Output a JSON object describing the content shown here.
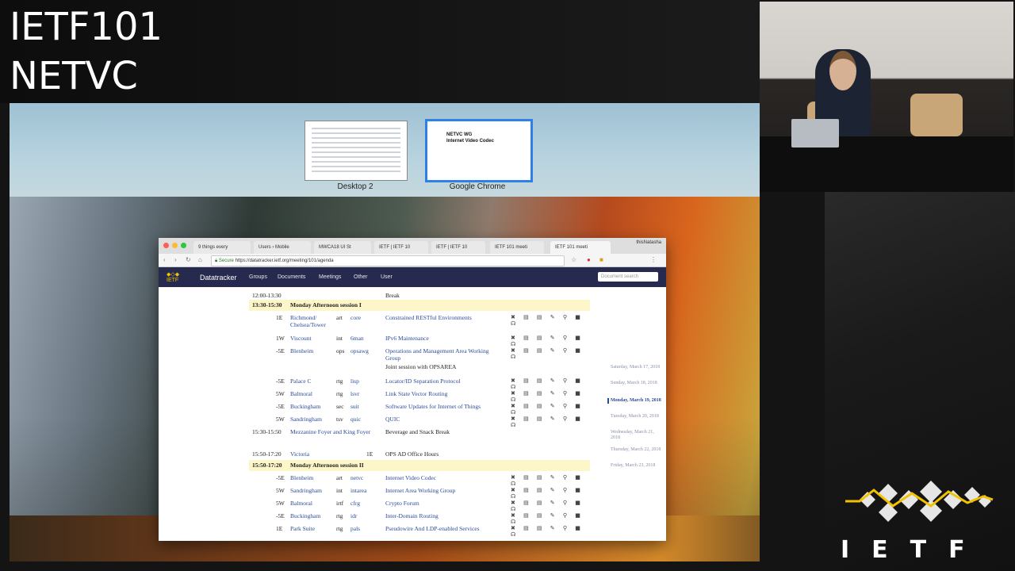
{
  "title": {
    "line1": "IETF101",
    "line2": "NETVC"
  },
  "spaces": [
    {
      "label": "Desktop 2"
    },
    {
      "label": "Google Chrome"
    }
  ],
  "thumb_slide": {
    "line1": "NETVC WG",
    "line2": "Internet Video Codec"
  },
  "browser": {
    "tabs": [
      "9 things every",
      "Users › Mobile",
      "MWCA18 UI St",
      "IETF | IETF 10",
      "IETF | IETF 10",
      "IETF 101 meeti",
      "IETF 101 meeti"
    ],
    "profile": "thisNatasha",
    "address": {
      "secure": "Secure",
      "url": "https://datatracker.ietf.org/meeting/101/agenda"
    },
    "site": {
      "logo": "IETF",
      "brand": "Datatracker",
      "nav": [
        "Groups",
        "Documents",
        "Meetings",
        "Other",
        "User"
      ],
      "search_placeholder": "Document search"
    }
  },
  "agenda": [
    {
      "type": "plain",
      "time": "12:00-13:30",
      "title": "Break"
    },
    {
      "type": "header",
      "time": "13:30-15:30",
      "title": "Monday Afternoon session I"
    },
    {
      "type": "session",
      "floor": "1E",
      "room": "Richmond/ Chelsea/Tower",
      "area": "art",
      "group": "core",
      "title": "Constrained RESTful Environments"
    },
    {
      "type": "session",
      "floor": "1W",
      "room": "Viscount",
      "area": "int",
      "group": "6man",
      "title": "IPv6 Maintenance"
    },
    {
      "type": "session",
      "floor": "-5E",
      "room": "Blenheim",
      "area": "ops",
      "group": "opsawg",
      "title": "Operations and Management Area Working Group",
      "note": "Joint session with OPSAREA"
    },
    {
      "type": "session",
      "floor": "-5E",
      "room": "Palace C",
      "area": "rtg",
      "group": "lisp",
      "title": "Locator/ID Separation Protocol"
    },
    {
      "type": "session",
      "floor": "5W",
      "room": "Balmoral",
      "area": "rtg",
      "group": "lsvr",
      "title": "Link State Vector Routing"
    },
    {
      "type": "session",
      "floor": "-5E",
      "room": "Buckingham",
      "area": "sec",
      "group": "suit",
      "title": "Software Updates for Internet of Things"
    },
    {
      "type": "session",
      "floor": "5W",
      "room": "Sandringham",
      "area": "tsv",
      "group": "quic",
      "title": "QUIC"
    },
    {
      "type": "plain",
      "time": "15:30-15:50",
      "room": "Mezzanine Foyer and King Foyer",
      "title": "Beverage and Snack Break"
    },
    {
      "type": "plain",
      "time": "15:50-17:20",
      "room": "Victoria",
      "floor": "1E",
      "title": "OPS AD Office Hours"
    },
    {
      "type": "header",
      "time": "15:50-17:20",
      "title": "Monday Afternoon session II"
    },
    {
      "type": "session",
      "floor": "-5E",
      "room": "Blenheim",
      "area": "art",
      "group": "netvc",
      "title": "Internet Video Codec"
    },
    {
      "type": "session",
      "floor": "5W",
      "room": "Sandringham",
      "area": "int",
      "group": "intarea",
      "title": "Internet Area Working Group"
    },
    {
      "type": "session",
      "floor": "5W",
      "room": "Balmoral",
      "area": "irtf",
      "group": "cfrg",
      "title": "Crypto Forum"
    },
    {
      "type": "session",
      "floor": "-5E",
      "room": "Buckingham",
      "area": "rtg",
      "group": "idr",
      "title": "Inter-Domain Routing"
    },
    {
      "type": "session",
      "floor": "1E",
      "room": "Park Suite",
      "area": "rtg",
      "group": "pals",
      "title": "Pseudowire And LDP-enabled Services"
    }
  ],
  "days": [
    "Saturday, March 17, 2018",
    "Sunday, March 18, 2018",
    "Monday, March 19, 2018",
    "Tuesday, March 20, 2018",
    "Wednesday, March 21, 2018",
    "Thursday, March 22, 2018",
    "Friday, March 23, 2018"
  ],
  "session_icons": "✖ ▤ ▤ ✎ ⚲ ■ ☊",
  "ietf_logo_text": "IETF",
  "colors": {
    "accent": "#f2c200",
    "nav": "#262a4f",
    "link": "#2b4b9b",
    "header_row": "#fdf6c8"
  }
}
